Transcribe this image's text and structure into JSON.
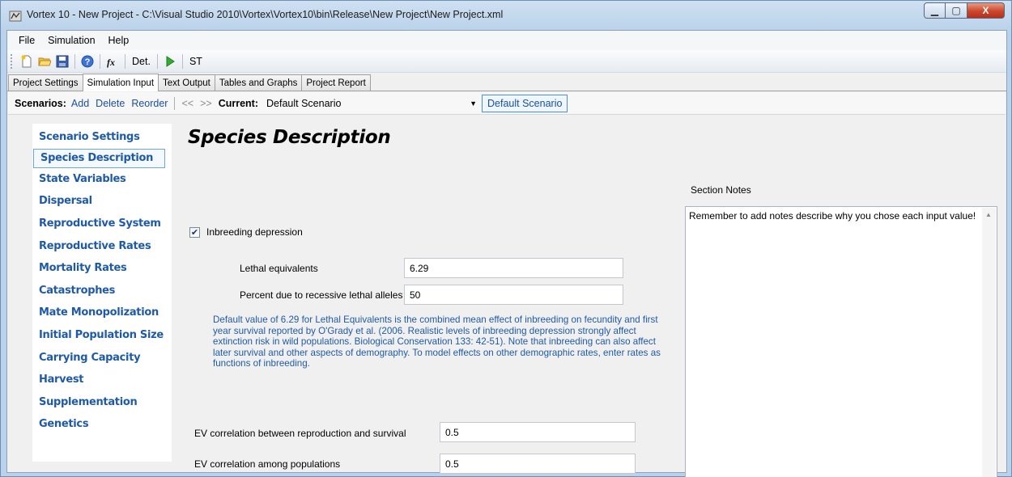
{
  "window": {
    "title": "Vortex 10 - New Project - C:\\Visual Studio 2010\\Vortex\\Vortex10\\bin\\Release\\New Project\\New Project.xml",
    "minimize_glyph": "▁",
    "maximize_glyph": "▢",
    "close_glyph": "X"
  },
  "menu": {
    "items": [
      "File",
      "Simulation",
      "Help"
    ]
  },
  "toolbar": {
    "det_label": "Det.",
    "st_label": "ST",
    "icons": [
      "new-icon",
      "open-folder-icon",
      "save-icon",
      "help-icon",
      "function-icon",
      "run-icon"
    ]
  },
  "tabs": [
    "Project Settings",
    "Simulation Input",
    "Text Output",
    "Tables and Graphs",
    "Project Report"
  ],
  "active_tab": "Simulation Input",
  "scenarios": {
    "label": "Scenarios:",
    "add": "Add",
    "delete": "Delete",
    "reorder": "Reorder",
    "prev": "<<",
    "next": ">>",
    "current_label": "Current:",
    "current_value": "Default Scenario",
    "scenario_button": "Default Scenario"
  },
  "nav": {
    "items": [
      "Scenario Settings",
      "Species Description",
      "State Variables",
      "Dispersal",
      "Reproductive System",
      "Reproductive Rates",
      "Mortality Rates",
      "Catastrophes",
      "Mate Monopolization",
      "Initial Population Size",
      "Carrying Capacity",
      "Harvest",
      "Supplementation",
      "Genetics"
    ],
    "active": "Species Description"
  },
  "content": {
    "title": "Species Description",
    "inbreeding_checkbox_label": "Inbreeding depression",
    "inbreeding_checked": true,
    "lethal_equivalents_label": "Lethal equivalents",
    "lethal_equivalents_value": "6.29",
    "percent_recessive_label": "Percent due to recessive lethal alleles",
    "percent_recessive_value": "50",
    "info_text": "Default value of 6.29 for Lethal Equivalents is the combined mean effect of inbreeding on fecundity and first year survival reported by O'Grady et al. (2006. Realistic levels of inbreeding depression strongly affect extinction risk in wild populations. Biological Conservation 133: 42-51). Note that inbreeding can also affect later survival and other aspects of demography. To model effects on other demographic rates, enter rates as functions of inbreeding.",
    "ev_repro_survival_label": "EV correlation between reproduction and survival",
    "ev_repro_survival_value": "0.5",
    "ev_populations_label": "EV correlation among populations",
    "ev_populations_value": "0.5"
  },
  "notes": {
    "label": "Section Notes",
    "text": "Remember to add notes describe why you chose each input value!"
  },
  "colors": {
    "link_blue": "#1f5aa8",
    "active_border": "#6fa5dd"
  }
}
